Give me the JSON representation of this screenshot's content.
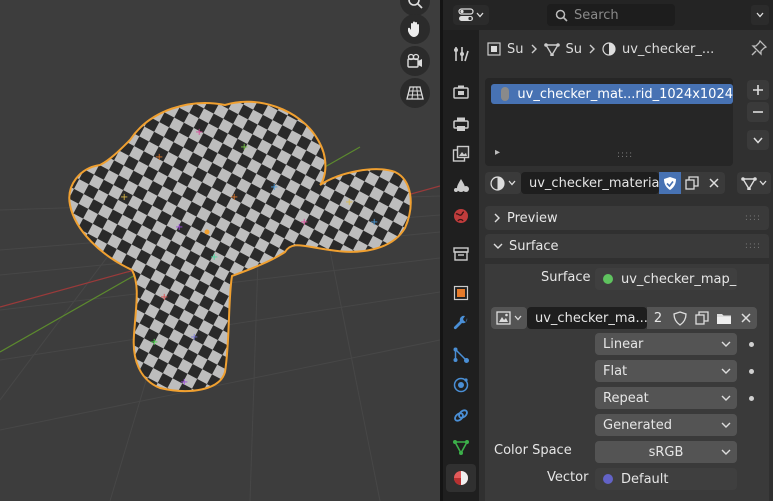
{
  "viewport": {
    "tools": [
      "zoom-tool",
      "pan-hand-tool",
      "camera-view-tool",
      "perspective-grid-tool"
    ]
  },
  "header": {
    "search_placeholder": "Search",
    "editor_type_icon": "properties-editor-icon"
  },
  "tabs": [
    {
      "icon": "tool-icon",
      "name": "tab-tool"
    },
    {
      "icon": "render-icon",
      "name": "tab-render"
    },
    {
      "icon": "output-icon",
      "name": "tab-output"
    },
    {
      "icon": "view-layer-icon",
      "name": "tab-view-layer"
    },
    {
      "icon": "scene-icon",
      "name": "tab-scene"
    },
    {
      "icon": "world-icon",
      "name": "tab-world"
    },
    {
      "icon": "collection-icon",
      "name": "tab-collection"
    },
    {
      "icon": "object-icon",
      "name": "tab-object"
    },
    {
      "icon": "modifier-icon",
      "name": "tab-modifiers"
    },
    {
      "icon": "particles-icon",
      "name": "tab-particles"
    },
    {
      "icon": "physics-icon",
      "name": "tab-physics"
    },
    {
      "icon": "constraints-icon",
      "name": "tab-constraints"
    },
    {
      "icon": "data-icon",
      "name": "tab-object-data"
    },
    {
      "icon": "material-icon",
      "name": "tab-material"
    }
  ],
  "breadcrumb": {
    "object": "Su",
    "mesh": "Su",
    "material": "uv_checker_..."
  },
  "material_slots": {
    "items": [
      {
        "name": "uv_checker_mat...rid_1024x1024",
        "selected": true
      }
    ],
    "footer": "▸",
    "grip": "::::"
  },
  "material_selector": {
    "name": "uv_checker_materia...",
    "fake_user": true
  },
  "panels": {
    "preview": "Preview",
    "surface": "Surface"
  },
  "surface": {
    "surface_label": "Surface",
    "surface_value": "uv_checker_map_...",
    "surface_socket_color": "#5fc35f",
    "image_name": "uv_checker_ma...",
    "image_users": "2",
    "interpolation": "Linear",
    "projection": "Flat",
    "extension": "Repeat",
    "source": "Generated",
    "color_space_label": "Color Space",
    "color_space": "sRGB",
    "vector_label": "Vector",
    "vector_value": "Default",
    "vector_socket_color": "#6363c7"
  },
  "colors": {
    "accent": "#4772b3",
    "outline": "#f0a030",
    "viewport_bg": "#3d3d3d"
  }
}
